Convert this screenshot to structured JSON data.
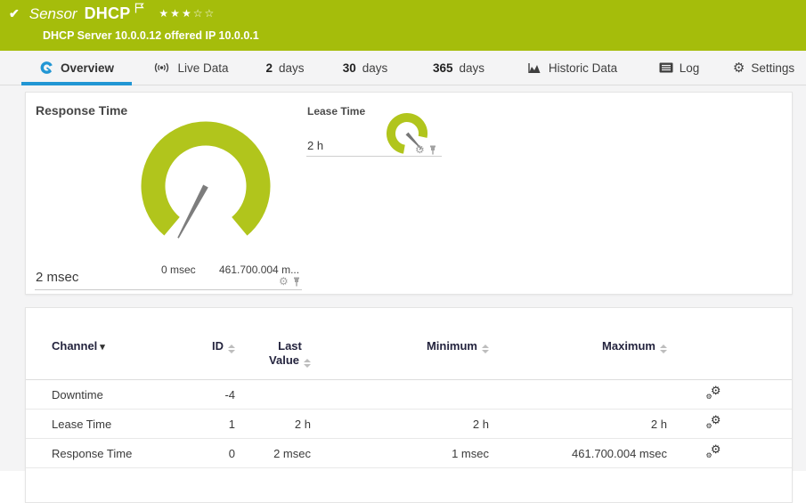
{
  "icons": {
    "check": "✔",
    "gear": "⚙",
    "stars_filled": "★★★",
    "stars_empty": "☆☆",
    "sort_desc": "▾"
  },
  "header": {
    "kind": "Sensor",
    "name": "DHCP",
    "subtitle": "DHCP Server 10.0.0.12 offered IP 10.0.0.1",
    "priority_filled": 3,
    "priority_total": 5,
    "bg_color": "#a5bd0b"
  },
  "tabs": [
    {
      "label": "Overview",
      "active": true
    },
    {
      "label": "Live Data"
    },
    {
      "num": "2",
      "label": "days"
    },
    {
      "num": "30",
      "label": "days"
    },
    {
      "num": "365",
      "label": "days"
    },
    {
      "label": "Historic Data"
    },
    {
      "label": "Log"
    },
    {
      "label": "Settings"
    }
  ],
  "gauges": {
    "response_time": {
      "title": "Response Time",
      "value": "2 msec",
      "scale_min": "0 msec",
      "scale_max": "461.700.004 m...",
      "color": "#b1c51c"
    },
    "lease_time": {
      "title": "Lease Time",
      "value": "2 h",
      "color": "#b1c51c"
    }
  },
  "table": {
    "headers": {
      "channel": "Channel",
      "id": "ID",
      "last1": "Last",
      "last2": "Value",
      "min": "Minimum",
      "max": "Maximum"
    },
    "rows": [
      {
        "channel": "Downtime",
        "id": "-4",
        "last": "",
        "min": "",
        "max": ""
      },
      {
        "channel": "Lease Time",
        "id": "1",
        "last": "2 h",
        "min": "2 h",
        "max": "2 h"
      },
      {
        "channel": "Response Time",
        "id": "0",
        "last": "2 msec",
        "min": "1 msec",
        "max": "461.700.004 msec"
      }
    ]
  },
  "colors": {
    "accent_blue": "#2196d4",
    "status_up_green": "#a5bd0b",
    "gauge_green": "#b1c51c"
  }
}
